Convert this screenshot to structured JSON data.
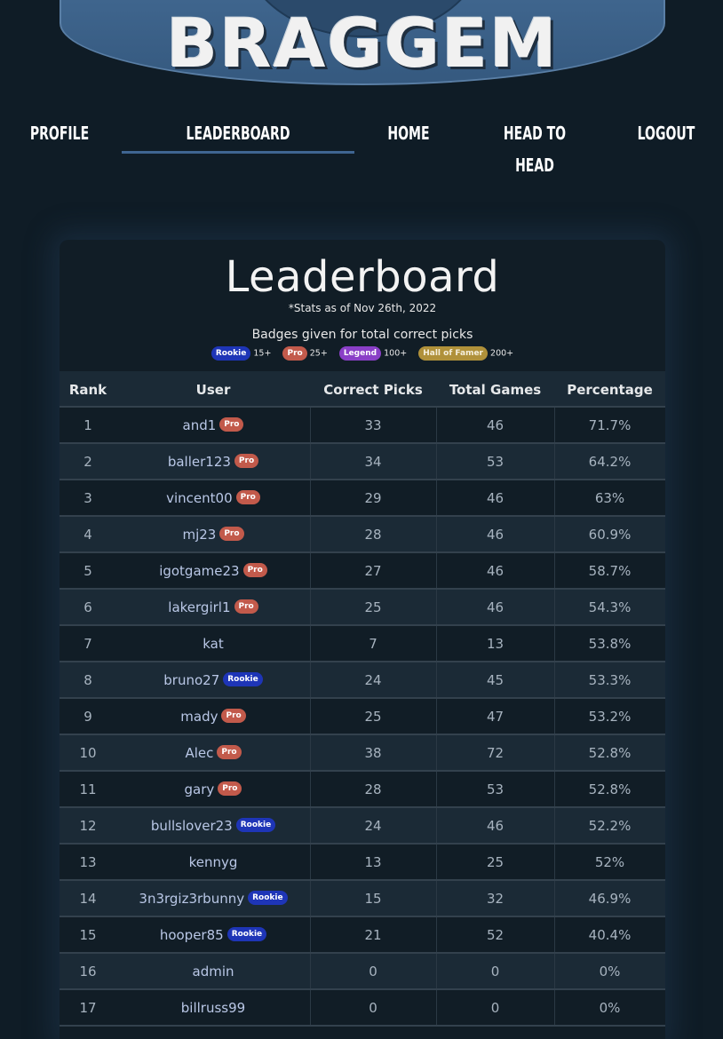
{
  "logo": {
    "text": "BRAGGEM"
  },
  "nav": {
    "profile": "PROFILE",
    "leaderboard": "LEADERBOARD",
    "home": "HOME",
    "head_to_head_1": "HEAD TO",
    "head_to_head_2": "HEAD",
    "logout": "LOGOUT",
    "active": "LEADERBOARD"
  },
  "leaderboard": {
    "title": "Leaderboard",
    "stats_note": "*Stats as of Nov 26th, 2022",
    "badge_note": "Badges given for total correct picks",
    "badges": [
      {
        "label": "Rookie",
        "threshold": "15+",
        "color": "#1e35b7"
      },
      {
        "label": "Pro",
        "threshold": "25+",
        "color": "#c25a4b"
      },
      {
        "label": "Legend",
        "threshold": "100+",
        "color": "#8a3fc7"
      },
      {
        "label": "Hall of Famer",
        "threshold": "200+",
        "color": "#b0913a"
      }
    ],
    "columns": {
      "rank": "Rank",
      "user": "User",
      "correct": "Correct Picks",
      "total": "Total Games",
      "percentage": "Percentage"
    },
    "rows": [
      {
        "rank": "1",
        "user": "and1",
        "badge": "Pro",
        "correct": "33",
        "total": "46",
        "pct": "71.7%"
      },
      {
        "rank": "2",
        "user": "baller123",
        "badge": "Pro",
        "correct": "34",
        "total": "53",
        "pct": "64.2%"
      },
      {
        "rank": "3",
        "user": "vincent00",
        "badge": "Pro",
        "correct": "29",
        "total": "46",
        "pct": "63%"
      },
      {
        "rank": "4",
        "user": "mj23",
        "badge": "Pro",
        "correct": "28",
        "total": "46",
        "pct": "60.9%"
      },
      {
        "rank": "5",
        "user": "igotgame23",
        "badge": "Pro",
        "correct": "27",
        "total": "46",
        "pct": "58.7%"
      },
      {
        "rank": "6",
        "user": "lakergirl1",
        "badge": "Pro",
        "correct": "25",
        "total": "46",
        "pct": "54.3%"
      },
      {
        "rank": "7",
        "user": "kat",
        "badge": "",
        "correct": "7",
        "total": "13",
        "pct": "53.8%"
      },
      {
        "rank": "8",
        "user": "bruno27",
        "badge": "Rookie",
        "correct": "24",
        "total": "45",
        "pct": "53.3%"
      },
      {
        "rank": "9",
        "user": "mady",
        "badge": "Pro",
        "correct": "25",
        "total": "47",
        "pct": "53.2%"
      },
      {
        "rank": "10",
        "user": "Alec",
        "badge": "Pro",
        "correct": "38",
        "total": "72",
        "pct": "52.8%"
      },
      {
        "rank": "11",
        "user": "gary",
        "badge": "Pro",
        "correct": "28",
        "total": "53",
        "pct": "52.8%"
      },
      {
        "rank": "12",
        "user": "bullslover23",
        "badge": "Rookie",
        "correct": "24",
        "total": "46",
        "pct": "52.2%"
      },
      {
        "rank": "13",
        "user": "kennyg",
        "badge": "",
        "correct": "13",
        "total": "25",
        "pct": "52%"
      },
      {
        "rank": "14",
        "user": "3n3rgiz3rbunny",
        "badge": "Rookie",
        "correct": "15",
        "total": "32",
        "pct": "46.9%"
      },
      {
        "rank": "15",
        "user": "hooper85",
        "badge": "Rookie",
        "correct": "21",
        "total": "52",
        "pct": "40.4%"
      },
      {
        "rank": "16",
        "user": "admin",
        "badge": "",
        "correct": "0",
        "total": "0",
        "pct": "0%"
      },
      {
        "rank": "17",
        "user": "billruss99",
        "badge": "",
        "correct": "0",
        "total": "0",
        "pct": "0%"
      }
    ]
  },
  "colors": {
    "background": "#0f1c26",
    "accent": "#3f6591",
    "rookie": "#1e35b7",
    "pro": "#c25a4b",
    "legend": "#8a3fc7",
    "hall_of_famer": "#b0913a"
  }
}
